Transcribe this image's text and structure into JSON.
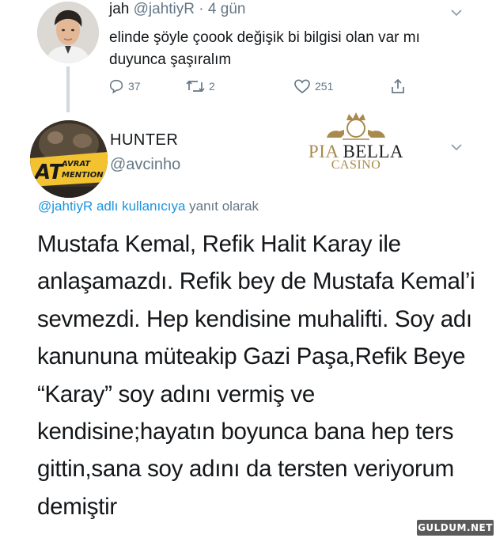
{
  "parent_tweet": {
    "name": "jah",
    "handle": "@jahtiyR",
    "separator": "·",
    "time": "4 gün",
    "text": "elinde şöyle çoook değişik bi bilgisi olan var mı duyunca şaşıralım",
    "actions": {
      "reply_count": "37",
      "retweet_count": "2",
      "like_count": "251"
    }
  },
  "reply_tweet": {
    "name": "HUNTER",
    "handle": "@avcinho",
    "avatar_badge": "AT AVRAT MENTION",
    "reply_to_mention": "@jahtiyR adlı kullanıcıya",
    "reply_to_suffix": "yanıt olarak",
    "text": "Mustafa Kemal, Refik Halit Karay ile anlaşamazdı. Refik bey de Mustafa Kemal’i sevmezdi. Hep kendisine muhalifti. Soy adı kanununa müteakip Gazi Paşa,Refik Beye “Karay” soy adını vermiş ve kendisine;hayatın boyunca bana hep ters gittin,sana soy adını da tersten veriyorum demiştir"
  },
  "watermark": {
    "brand_first": "PIA",
    "brand_second": "BELLA",
    "brand_sub": "CASINO",
    "brand_monogram": "PB"
  },
  "site_mark": "GULDUM.NET",
  "colors": {
    "text_primary": "#14171a",
    "text_secondary": "#657786",
    "link": "#1b95e0",
    "gold": "#a88a4c"
  }
}
